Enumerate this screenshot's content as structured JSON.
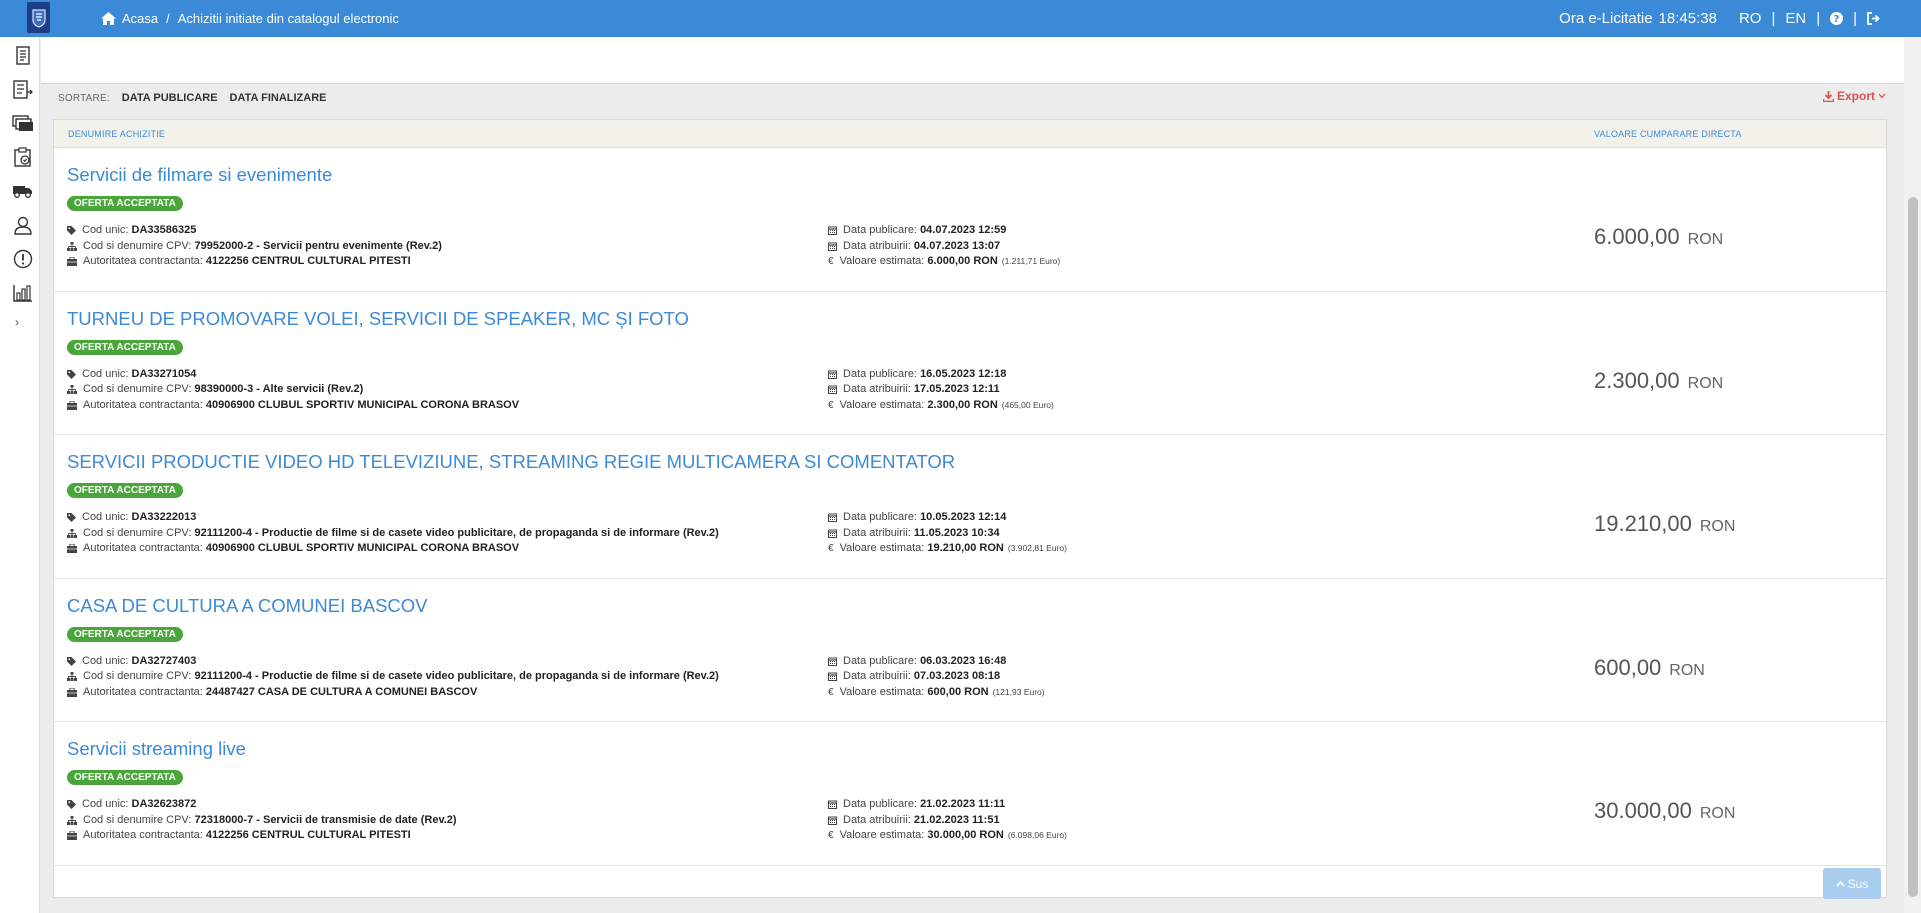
{
  "topbar": {
    "breadcrumb_home": "Acasa",
    "breadcrumb_sep": "/",
    "breadcrumb_current": "Achizitii initiate din catalogul electronic",
    "clock_label": "Ora e-Licitatie",
    "clock_time": "18:45:38",
    "lang_ro": "RO",
    "lang_en": "EN",
    "pipe": "|"
  },
  "sort": {
    "label": "SORTARE:",
    "option_1": "DATA PUBLICARE",
    "option_2": "DATA FINALIZARE"
  },
  "export_label": "Export",
  "table": {
    "col_name": "DENUMIRE ACHIZITIE",
    "col_value": "VALOARE CUMPARARE DIRECTA"
  },
  "labels": {
    "cod_unic": "Cod unic:",
    "cod_cpv": "Cod si denumire CPV:",
    "autoritate": "Autoritatea contractanta:",
    "data_publicare": "Data publicare:",
    "data_atribuirii": "Data atribuirii:",
    "valoare_estimata": "Valoare estimata:",
    "ron": "RON",
    "euro": "Euro"
  },
  "rows": [
    {
      "title": "Servicii de filmare si evenimente",
      "badge": "OFERTA ACCEPTATA",
      "cod_unic": "DA33586325",
      "cpv": "79952000-2 - Servicii pentru evenimente (Rev.2)",
      "autoritate": "4122256 CENTRUL CULTURAL PITESTI",
      "data_publicare": "04.07.2023 12:59",
      "data_atribuirii": "04.07.2023 13:07",
      "valoare_estimata": "6.000,00",
      "valoare_euro": "(1.211,71",
      "valoare": "6.000,00"
    },
    {
      "title": "TURNEU DE PROMOVARE VOLEI, SERVICII DE SPEAKER, MC ȘI FOTO",
      "badge": "OFERTA ACCEPTATA",
      "cod_unic": "DA33271054",
      "cpv": "98390000-3 - Alte servicii (Rev.2)",
      "autoritate": "40906900 CLUBUL SPORTIV MUNICIPAL CORONA BRASOV",
      "data_publicare": "16.05.2023 12:18",
      "data_atribuirii": "17.05.2023 12:11",
      "valoare_estimata": "2.300,00",
      "valoare_euro": "(465,00",
      "valoare": "2.300,00"
    },
    {
      "title": "SERVICII PRODUCTIE VIDEO HD TELEVIZIUNE, STREAMING REGIE MULTICAMERA SI COMENTATOR",
      "badge": "OFERTA ACCEPTATA",
      "cod_unic": "DA33222013",
      "cpv": "92111200-4 - Productie de filme si de casete video publicitare, de propaganda si de informare (Rev.2)",
      "autoritate": "40906900 CLUBUL SPORTIV MUNICIPAL CORONA BRASOV",
      "data_publicare": "10.05.2023 12:14",
      "data_atribuirii": "11.05.2023 10:34",
      "valoare_estimata": "19.210,00",
      "valoare_euro": "(3.902,81",
      "valoare": "19.210,00"
    },
    {
      "title": "CASA DE CULTURA A COMUNEI BASCOV",
      "badge": "OFERTA ACCEPTATA",
      "cod_unic": "DA32727403",
      "cpv": "92111200-4 - Productie de filme si de casete video publicitare, de propaganda si de informare (Rev.2)",
      "autoritate": "24487427 CASA DE CULTURA A COMUNEI BASCOV",
      "data_publicare": "06.03.2023 16:48",
      "data_atribuirii": "07.03.2023 08:18",
      "valoare_estimata": "600,00",
      "valoare_euro": "(121,93",
      "valoare": "600,00"
    },
    {
      "title": "Servicii streaming live",
      "badge": "OFERTA ACCEPTATA",
      "cod_unic": "DA32623872",
      "cpv": "72318000-7 - Servicii de transmisie de date (Rev.2)",
      "autoritate": "4122256 CENTRUL CULTURAL PITESTI",
      "data_publicare": "21.02.2023 11:11",
      "data_atribuirii": "21.02.2023 11:51",
      "valoare_estimata": "30.000,00",
      "valoare_euro": "(6.098,06",
      "valoare": "30.000,00"
    }
  ],
  "sus_label": "Sus",
  "colors": {
    "topbar": "#3b8ad8",
    "link": "#3b8ad8",
    "badge": "#4aa63a",
    "export": "#d9534f"
  }
}
